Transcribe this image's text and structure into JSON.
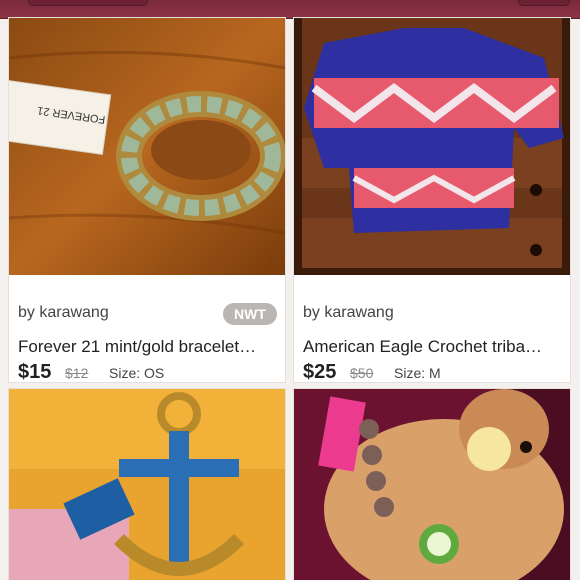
{
  "listings": [
    {
      "seller": "by karawang",
      "badge": "NWT",
      "title": "Forever 21 mint/gold bracelet…",
      "price": "$15",
      "original_price": "$12",
      "size": "Size: OS",
      "tag_text": "FOREVER 21"
    },
    {
      "seller": "by karawang",
      "badge": "",
      "title": "American Eagle Crochet triba…",
      "price": "$25",
      "original_price": "$50",
      "size": "Size: M"
    },
    {
      "seller": "",
      "title": "",
      "price": "",
      "original_price": "",
      "size": ""
    },
    {
      "seller": "",
      "title": "",
      "price": "",
      "original_price": "",
      "size": ""
    }
  ],
  "colors": {
    "topbar": "#8c3346",
    "page_bg": "#f3f0ee"
  },
  "icons": {
    "left": "nav-button",
    "right": "nav-button"
  }
}
